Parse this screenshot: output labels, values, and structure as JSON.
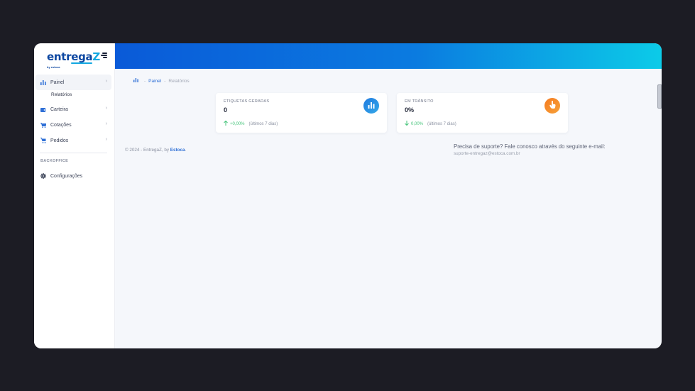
{
  "brand": {
    "name_main": "entrega",
    "name_accent": "Z",
    "sub": "by estoca"
  },
  "colors": {
    "primary": "#2e6fd6",
    "badge_blue": "#2f8fe0",
    "badge_orange": "#f2802c",
    "positive": "#45c47a",
    "header_start": "#0a5ad8",
    "header_end": "#0ccbe8"
  },
  "sidebar": {
    "items": [
      {
        "label": "Painel",
        "icon": "bar-chart-icon",
        "chevron": "›"
      },
      {
        "label": "Carteira",
        "icon": "wallet-icon",
        "chevron": "›"
      },
      {
        "label": "Cotações",
        "icon": "cart-icon",
        "chevron": "›"
      },
      {
        "label": "Pedidos",
        "icon": "orders-icon",
        "chevron": "›"
      }
    ],
    "sub_item": "Relatórios",
    "section_title": "BACKOFFICE",
    "config_label": "Configurações"
  },
  "breadcrumb": {
    "sep": "-",
    "link": "Painel",
    "current": "Relatórios"
  },
  "cards": [
    {
      "title": "ETIQUETAS GERADAS",
      "value": "0",
      "delta": "+0,00%",
      "note": "(últimos 7 dias)",
      "icon": "bar-chart-icon"
    },
    {
      "title": "EM TRÂNSITO",
      "value": "0%",
      "delta": "0,00%",
      "note": "(últimos 7 dias)",
      "icon": "hand-pointer-icon"
    }
  ],
  "footer": {
    "copyright": "© 2024 - EntregaZ, by ",
    "company": "Estoca",
    "period": ".",
    "support_title": "Precisa de suporte? Fale conosco através do seguinte e-mail:",
    "support_email": "suporte-entregaz@estoca.com.br"
  }
}
